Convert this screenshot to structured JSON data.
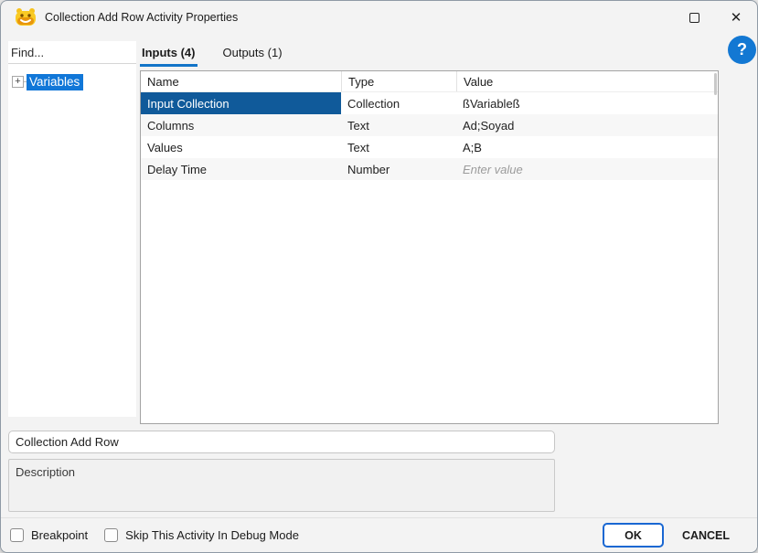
{
  "window": {
    "title": "Collection Add Row Activity Properties"
  },
  "icons": {
    "app": "robot-icon",
    "maximize": "maximize-icon",
    "close": "✕",
    "help": "?",
    "tree_expander": "+"
  },
  "colors": {
    "cell_selection": "#105a9a",
    "tree_selection": "#1177d8",
    "tab_accent": "#1274c8",
    "help_accent": "#1378d3",
    "ok_accent": "#1967d2"
  },
  "sidebar": {
    "find_placeholder": "Find...",
    "tree": [
      {
        "label": "Variables",
        "selected": true,
        "expanded": false
      }
    ]
  },
  "tabs": [
    {
      "label": "Inputs (4)",
      "active": true
    },
    {
      "label": "Outputs (1)",
      "active": false
    }
  ],
  "table": {
    "headers": [
      "Name",
      "Type",
      "Value"
    ],
    "rows": [
      {
        "name": "Input Collection",
        "type": "Collection",
        "value": "ßVariableß",
        "selected": true,
        "placeholder": false
      },
      {
        "name": "Columns",
        "type": "Text",
        "value": "Ad;Soyad",
        "selected": false,
        "placeholder": false
      },
      {
        "name": "Values",
        "type": "Text",
        "value": "A;B",
        "selected": false,
        "placeholder": false
      },
      {
        "name": "Delay Time",
        "type": "Number",
        "value": "Enter value",
        "selected": false,
        "placeholder": true
      }
    ]
  },
  "activity": {
    "name_value": "Collection Add Row",
    "description_placeholder": "Description"
  },
  "footer": {
    "checkboxes": [
      {
        "label": "Breakpoint",
        "checked": false
      },
      {
        "label": "Skip This Activity In Debug Mode",
        "checked": false
      }
    ],
    "ok_label": "OK",
    "cancel_label": "CANCEL"
  }
}
